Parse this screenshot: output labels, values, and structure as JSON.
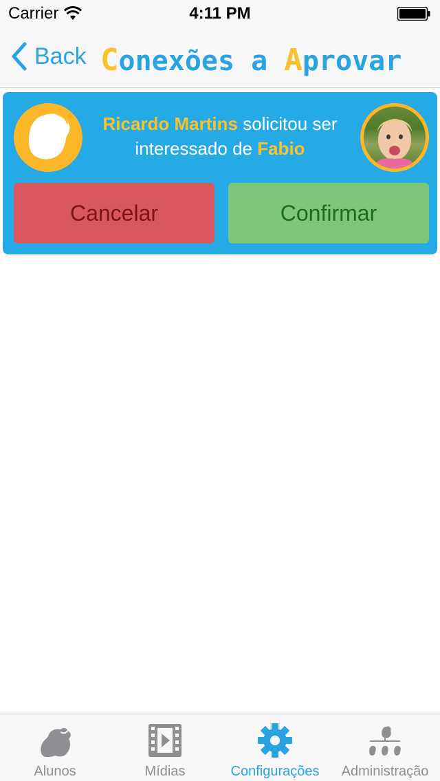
{
  "status_bar": {
    "carrier": "Carrier",
    "time": "4:11 PM"
  },
  "nav": {
    "back_label": "Back",
    "title_parts": [
      "C",
      "onexões a ",
      "A",
      "provar"
    ]
  },
  "request": {
    "requester_name": "Ricardo Martins",
    "text_middle": " solicitou ser interessado de ",
    "student_name": "Fabio",
    "cancel_label": "Cancelar",
    "confirm_label": "Confirmar"
  },
  "tabs": [
    {
      "label": "Alunos",
      "icon": "students-icon",
      "active": false
    },
    {
      "label": "Mídias",
      "icon": "film-icon",
      "active": false
    },
    {
      "label": "Configurações",
      "icon": "gear-icon",
      "active": true
    },
    {
      "label": "Administração",
      "icon": "admin-hierarchy-icon",
      "active": false
    }
  ],
  "colors": {
    "accent_blue": "#2aa3e1",
    "accent_yellow": "#fbc12d",
    "card_blue": "#25aae6",
    "cancel_red": "#d9575f",
    "confirm_green": "#7ec67b"
  }
}
